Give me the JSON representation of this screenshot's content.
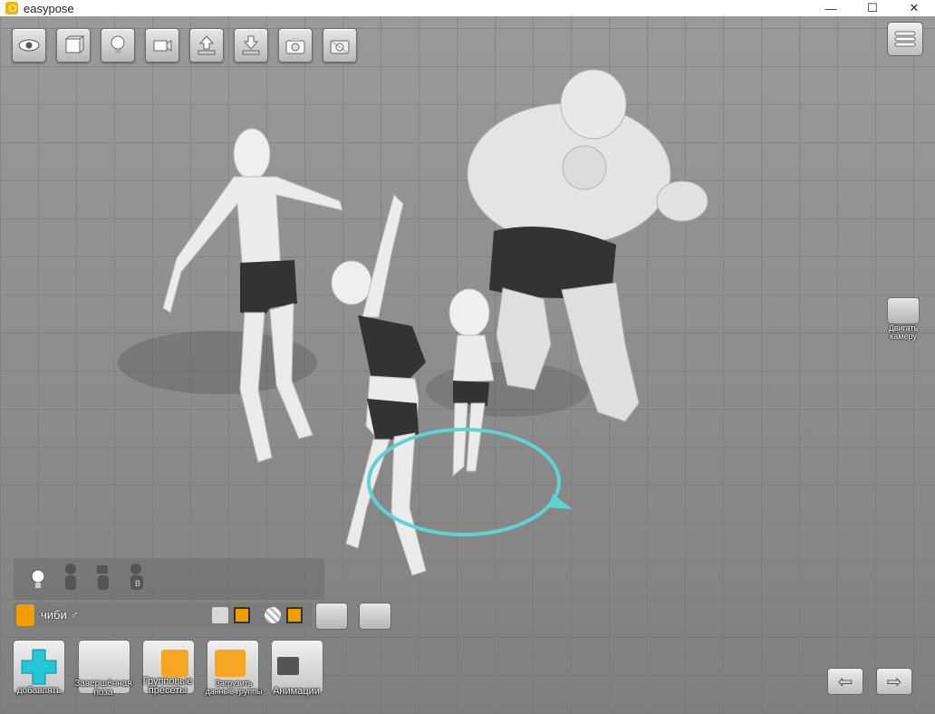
{
  "window": {
    "title": "easypose",
    "minimize": "—",
    "maximize": "☐",
    "close": "✕"
  },
  "toolbar": {
    "buttons": [
      "eye-icon",
      "cube-icon",
      "lightbulb-icon",
      "camera-move-icon",
      "upload-icon",
      "download-icon",
      "camera-icon",
      "camera-transparent-icon"
    ]
  },
  "side": {
    "move_camera_line1": "Двигать",
    "move_camera_line2": "камеру"
  },
  "panel": {
    "model_name": "чиби",
    "model_name_mark": "♂"
  },
  "bottom_buttons": {
    "add": "добавлять",
    "finished_pose_line1": "Завершённая",
    "finished_pose_line2": "поза",
    "group_presets_line1": "Групповые",
    "group_presets_line2": "пресеты",
    "load_group_line1": "Загрузить",
    "load_group_line2": "данные группы",
    "animations": "Анимации"
  },
  "nav": {
    "back": "⇦",
    "forward": "⇨"
  },
  "colors": {
    "accent": "#f39c00",
    "selection_ring": "#5fd3d3",
    "add_cross": "#22c7d6"
  }
}
